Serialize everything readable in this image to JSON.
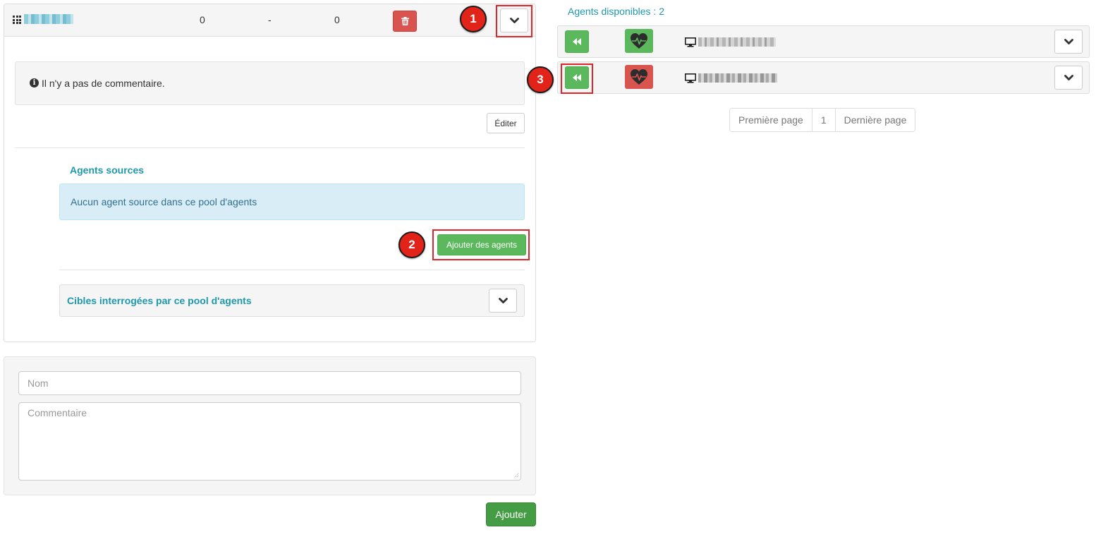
{
  "pool": {
    "stat_1": "0",
    "stat_2": "-",
    "stat_3": "0",
    "comment_text": "Il n'y a pas de commentaire.",
    "edit_label": "Éditer",
    "agents_sources_title": "Agents sources",
    "no_agent_message": "Aucun agent source dans ce pool d'agents",
    "add_agents_label": "Ajouter des agents",
    "targets_title": "Cibles interrogées par ce pool d'agents"
  },
  "form": {
    "name_placeholder": "Nom",
    "comment_placeholder": "Commentaire",
    "submit_label": "Ajouter"
  },
  "available": {
    "title": "Agents disponibles : 2",
    "agents": [
      {
        "health_color": "#5cb85c",
        "status": "healthy"
      },
      {
        "health_color": "#d9534f",
        "status": "unhealthy"
      }
    ]
  },
  "pagination": {
    "first_label": "Première page",
    "current_page": "1",
    "last_label": "Dernière page"
  },
  "markers": [
    "1",
    "2",
    "3"
  ],
  "icons": {
    "pool": "grid-icon",
    "delete": "trash-icon",
    "expand": "chevron-down-icon",
    "info": "info-circle-icon",
    "move": "backward-icon",
    "health": "heartbeat-icon",
    "agent": "desktop-icon"
  },
  "colors": {
    "accent": "#1f98ab",
    "success": "#5cb85c",
    "danger": "#d9534f",
    "annotation": "#e2231a"
  }
}
